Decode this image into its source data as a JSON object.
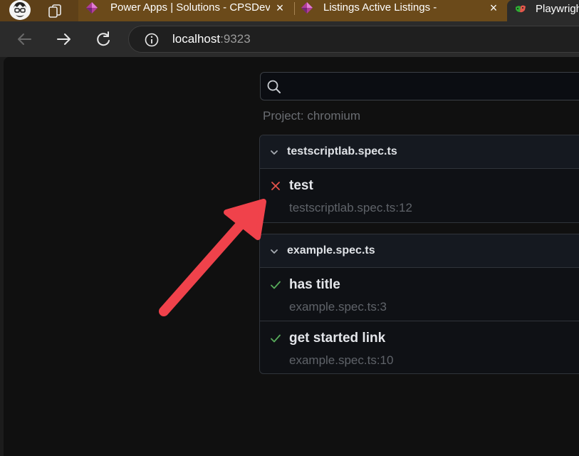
{
  "browser": {
    "tabs": [
      {
        "title": "Power Apps | Solutions - CPSDevC",
        "active": false
      },
      {
        "title": "Listings Active Listings -",
        "active": false
      },
      {
        "title": "Playwrigh",
        "active": true
      }
    ],
    "address": {
      "host": "localhost",
      "port": ":9323"
    },
    "icons": {
      "back": "arrow-left-icon",
      "forward": "arrow-right-icon",
      "reload": "reload-icon",
      "info": "info-icon",
      "workspaces": "workspaces-icon",
      "close": "close-icon"
    }
  },
  "report": {
    "search": {
      "value": "",
      "placeholder": ""
    },
    "project_label": "Project: chromium",
    "groups": [
      {
        "file": "testscriptlab.spec.ts",
        "tests": [
          {
            "name": "test",
            "location": "testscriptlab.spec.ts:12",
            "status": "failed"
          }
        ]
      },
      {
        "file": "example.spec.ts",
        "tests": [
          {
            "name": "has title",
            "location": "example.spec.ts:3",
            "status": "passed"
          },
          {
            "name": "get started link",
            "location": "example.spec.ts:10",
            "status": "passed"
          }
        ]
      }
    ]
  },
  "colors": {
    "tabstrip": "#6b4a1a",
    "fail": "#e5534b",
    "pass": "#57ab5a",
    "annotation": "#f0424b"
  }
}
